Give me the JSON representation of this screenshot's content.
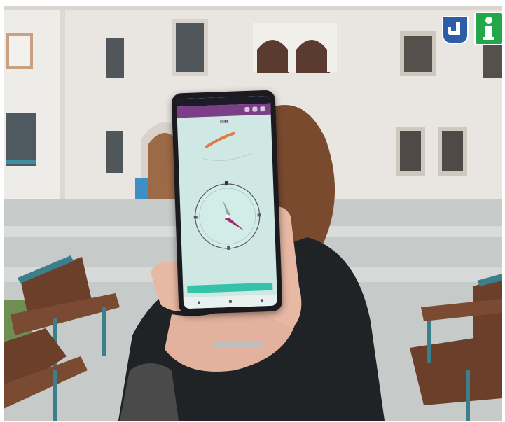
{
  "photo": {
    "subject": "phone-held-with-compass-app",
    "icons": [
      {
        "name": "accessibility-sign-icon",
        "color": "#2e5da8"
      },
      {
        "name": "info-icon",
        "color": "#22a84a",
        "glyph": "i"
      }
    ],
    "colors": {
      "building": "#e9e6e1",
      "sky_window": "#556066",
      "pavement": "#c3c7c6",
      "bench_wood": "#6b3f2a",
      "bench_frame": "#3a7f8a",
      "jacket": "#1f2326",
      "hair": "#7a4a2e",
      "skin": "#e7b8a4",
      "app_bar": "#7a3f86",
      "app_bg": "#cfe8e4",
      "app_button": "#34c2a8",
      "needle": "#9a2f6e"
    }
  }
}
